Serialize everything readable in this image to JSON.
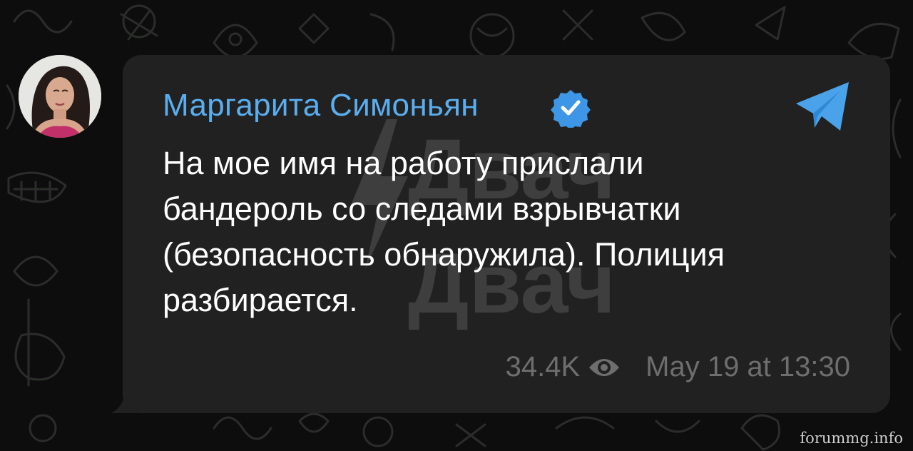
{
  "channel": {
    "name": "Маргарита Симоньян",
    "verified": true,
    "avatar_icon": "user-avatar",
    "app_icon": "telegram-icon",
    "accent_color": "#5aaeef"
  },
  "post": {
    "text": "На мое имя на работу прислали\nбандероль со следами взрывчатки\n(безопасность обнаружила). Полиция\nразбирается.",
    "views": "34.4K",
    "timestamp": "May 19 at 13:30"
  },
  "watermark": {
    "logo_text": "Двач"
  },
  "site_watermark": "forummg.info",
  "colors": {
    "bubble_bg": "#212121",
    "page_bg": "#0d0d0d",
    "meta_text": "#6e6e6e"
  }
}
